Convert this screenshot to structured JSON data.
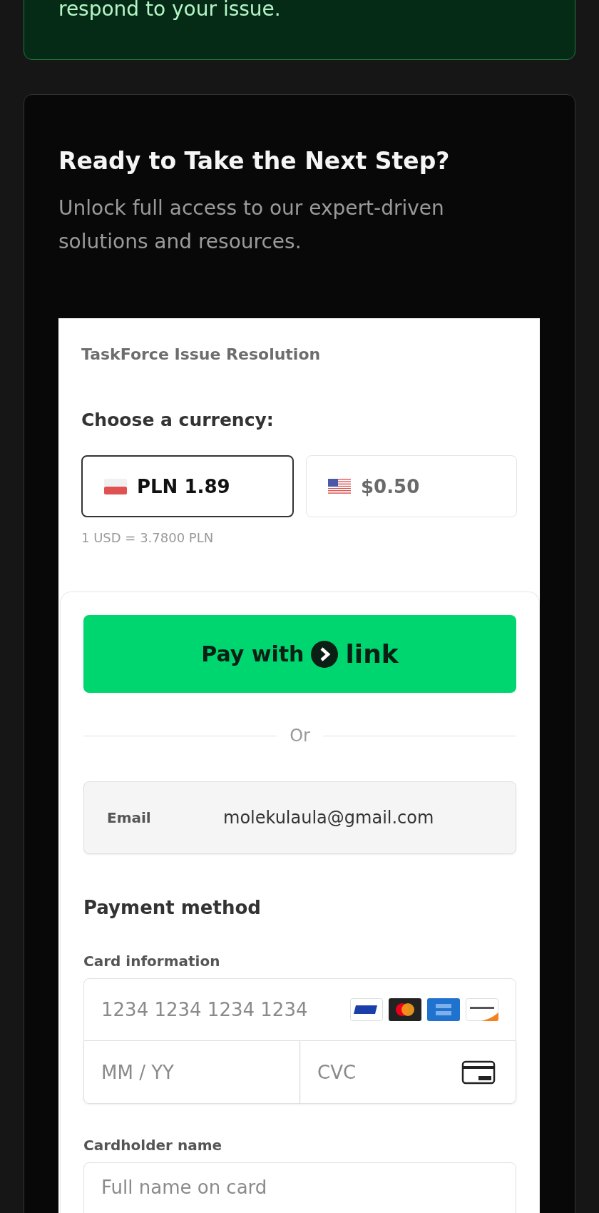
{
  "notice": {
    "text": "respond to your issue."
  },
  "cta": {
    "title": "Ready to Take the Next Step?",
    "subtitle": "Unlock full access to our expert-driven solutions and resources."
  },
  "checkout": {
    "product": "TaskForce Issue Resolution",
    "currency_label": "Choose a currency:",
    "currencies": [
      {
        "kind": "pl",
        "amount": "PLN 1.89",
        "selected": true
      },
      {
        "kind": "us",
        "amount": "$0.50",
        "selected": false
      }
    ],
    "rate": "1 USD = 3.7800 PLN",
    "link_button": {
      "prefix": "Pay with",
      "brand": "link"
    },
    "divider": "Or",
    "email": {
      "label": "Email",
      "value": "molekulaula@gmail.com"
    },
    "payment_title": "Payment method",
    "card": {
      "label": "Card information",
      "number_placeholder": "1234 1234 1234 1234",
      "expiry_placeholder": "MM / YY",
      "cvc_placeholder": "CVC",
      "brands": [
        {
          "kind": "visa"
        },
        {
          "kind": "mastercard"
        },
        {
          "kind": "amex"
        },
        {
          "kind": "discover"
        }
      ]
    },
    "cardholder": {
      "label": "Cardholder name",
      "placeholder": "Full name on card"
    }
  }
}
